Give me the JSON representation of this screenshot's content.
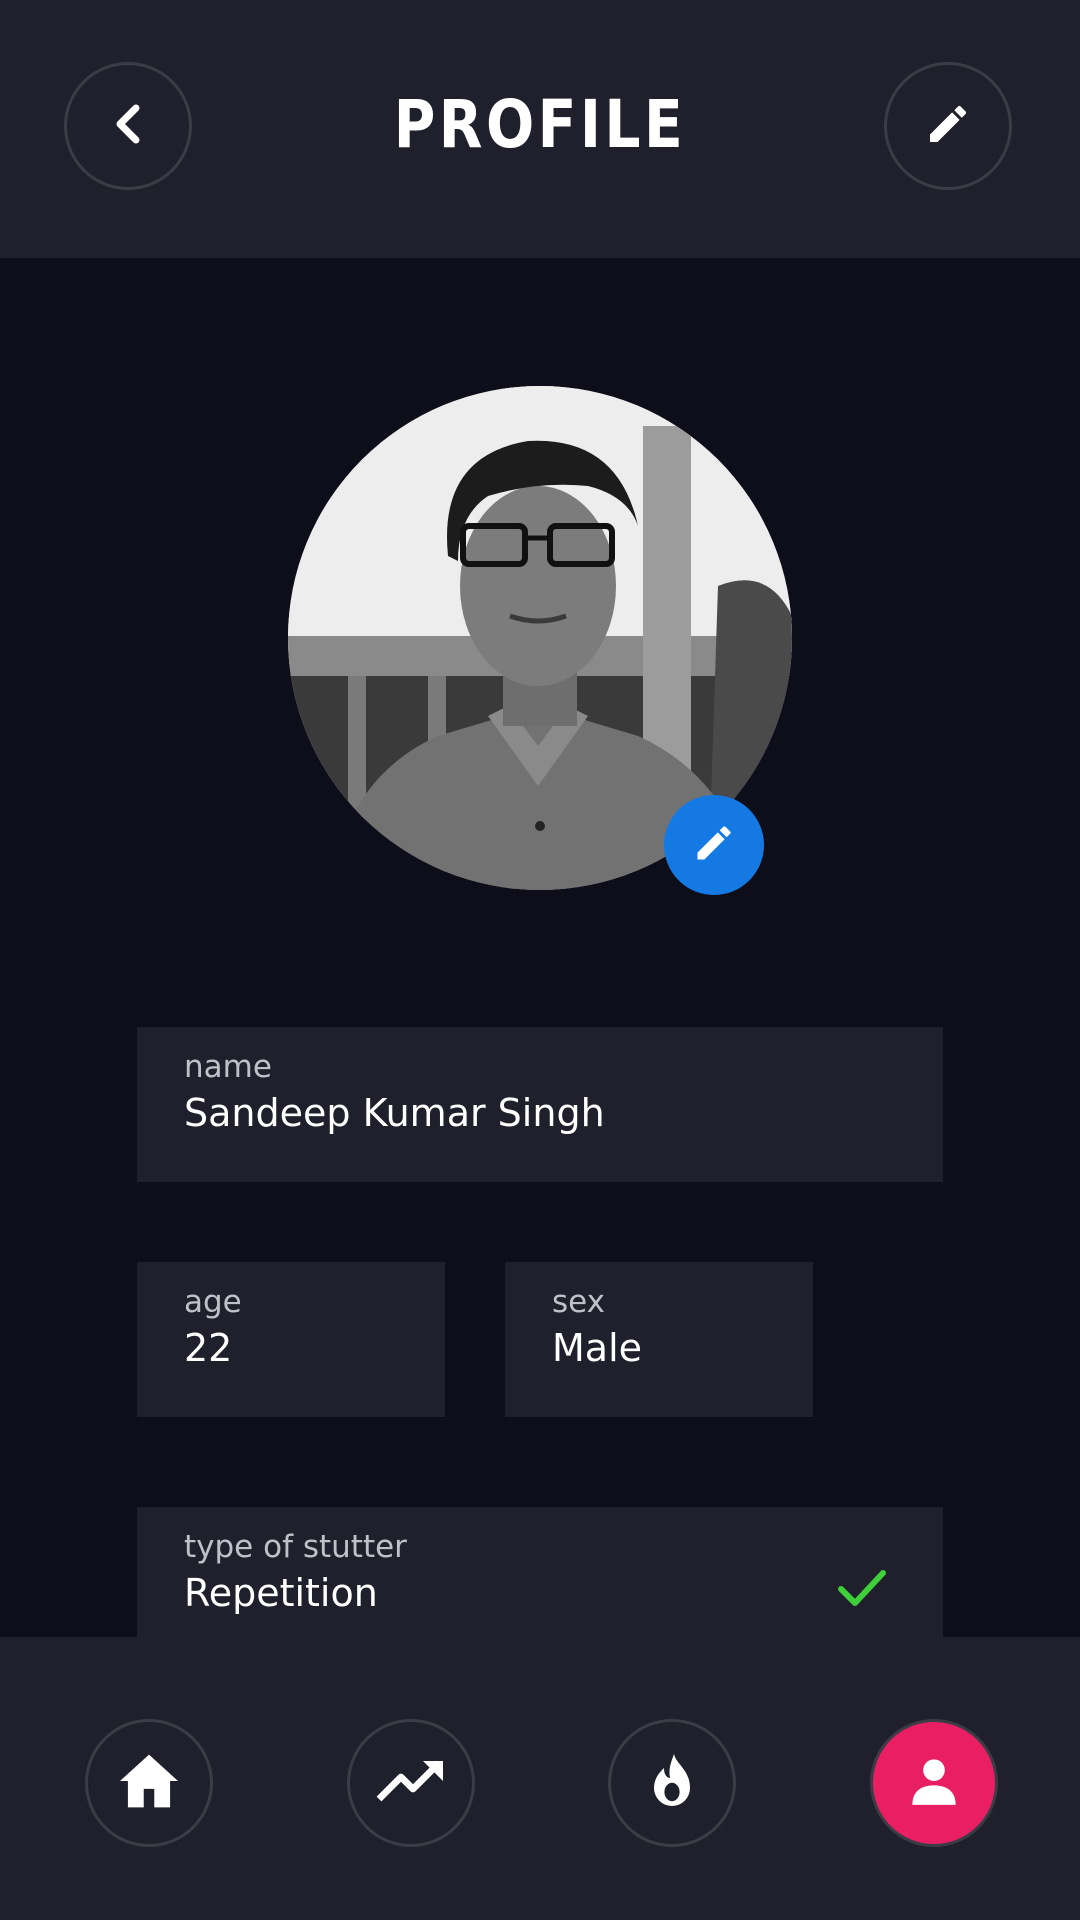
{
  "header": {
    "title": "PROFILE",
    "back_icon": "chevron-left-icon",
    "edit_icon": "pencil-icon"
  },
  "avatar": {
    "edit_icon": "pencil-icon",
    "edit_color": "#1479e3"
  },
  "fields": {
    "name": {
      "label": "name",
      "value": "Sandeep Kumar Singh"
    },
    "age": {
      "label": "age",
      "value": "22"
    },
    "sex": {
      "label": "sex",
      "value": "Male"
    },
    "stutter": {
      "label": "type of stutter",
      "value": "Repetition",
      "status_icon": "check-icon",
      "status_color": "#3ecf3a"
    }
  },
  "nav": {
    "items": [
      {
        "icon": "home-icon",
        "active": false
      },
      {
        "icon": "trending-up-icon",
        "active": false
      },
      {
        "icon": "flame-icon",
        "active": false
      },
      {
        "icon": "person-icon",
        "active": true
      }
    ],
    "active_color": "#e91e63"
  },
  "colors": {
    "background": "#0e0e1a",
    "surface": "#1f202c",
    "text": "#ffffff",
    "label": "#bfc0c8"
  }
}
